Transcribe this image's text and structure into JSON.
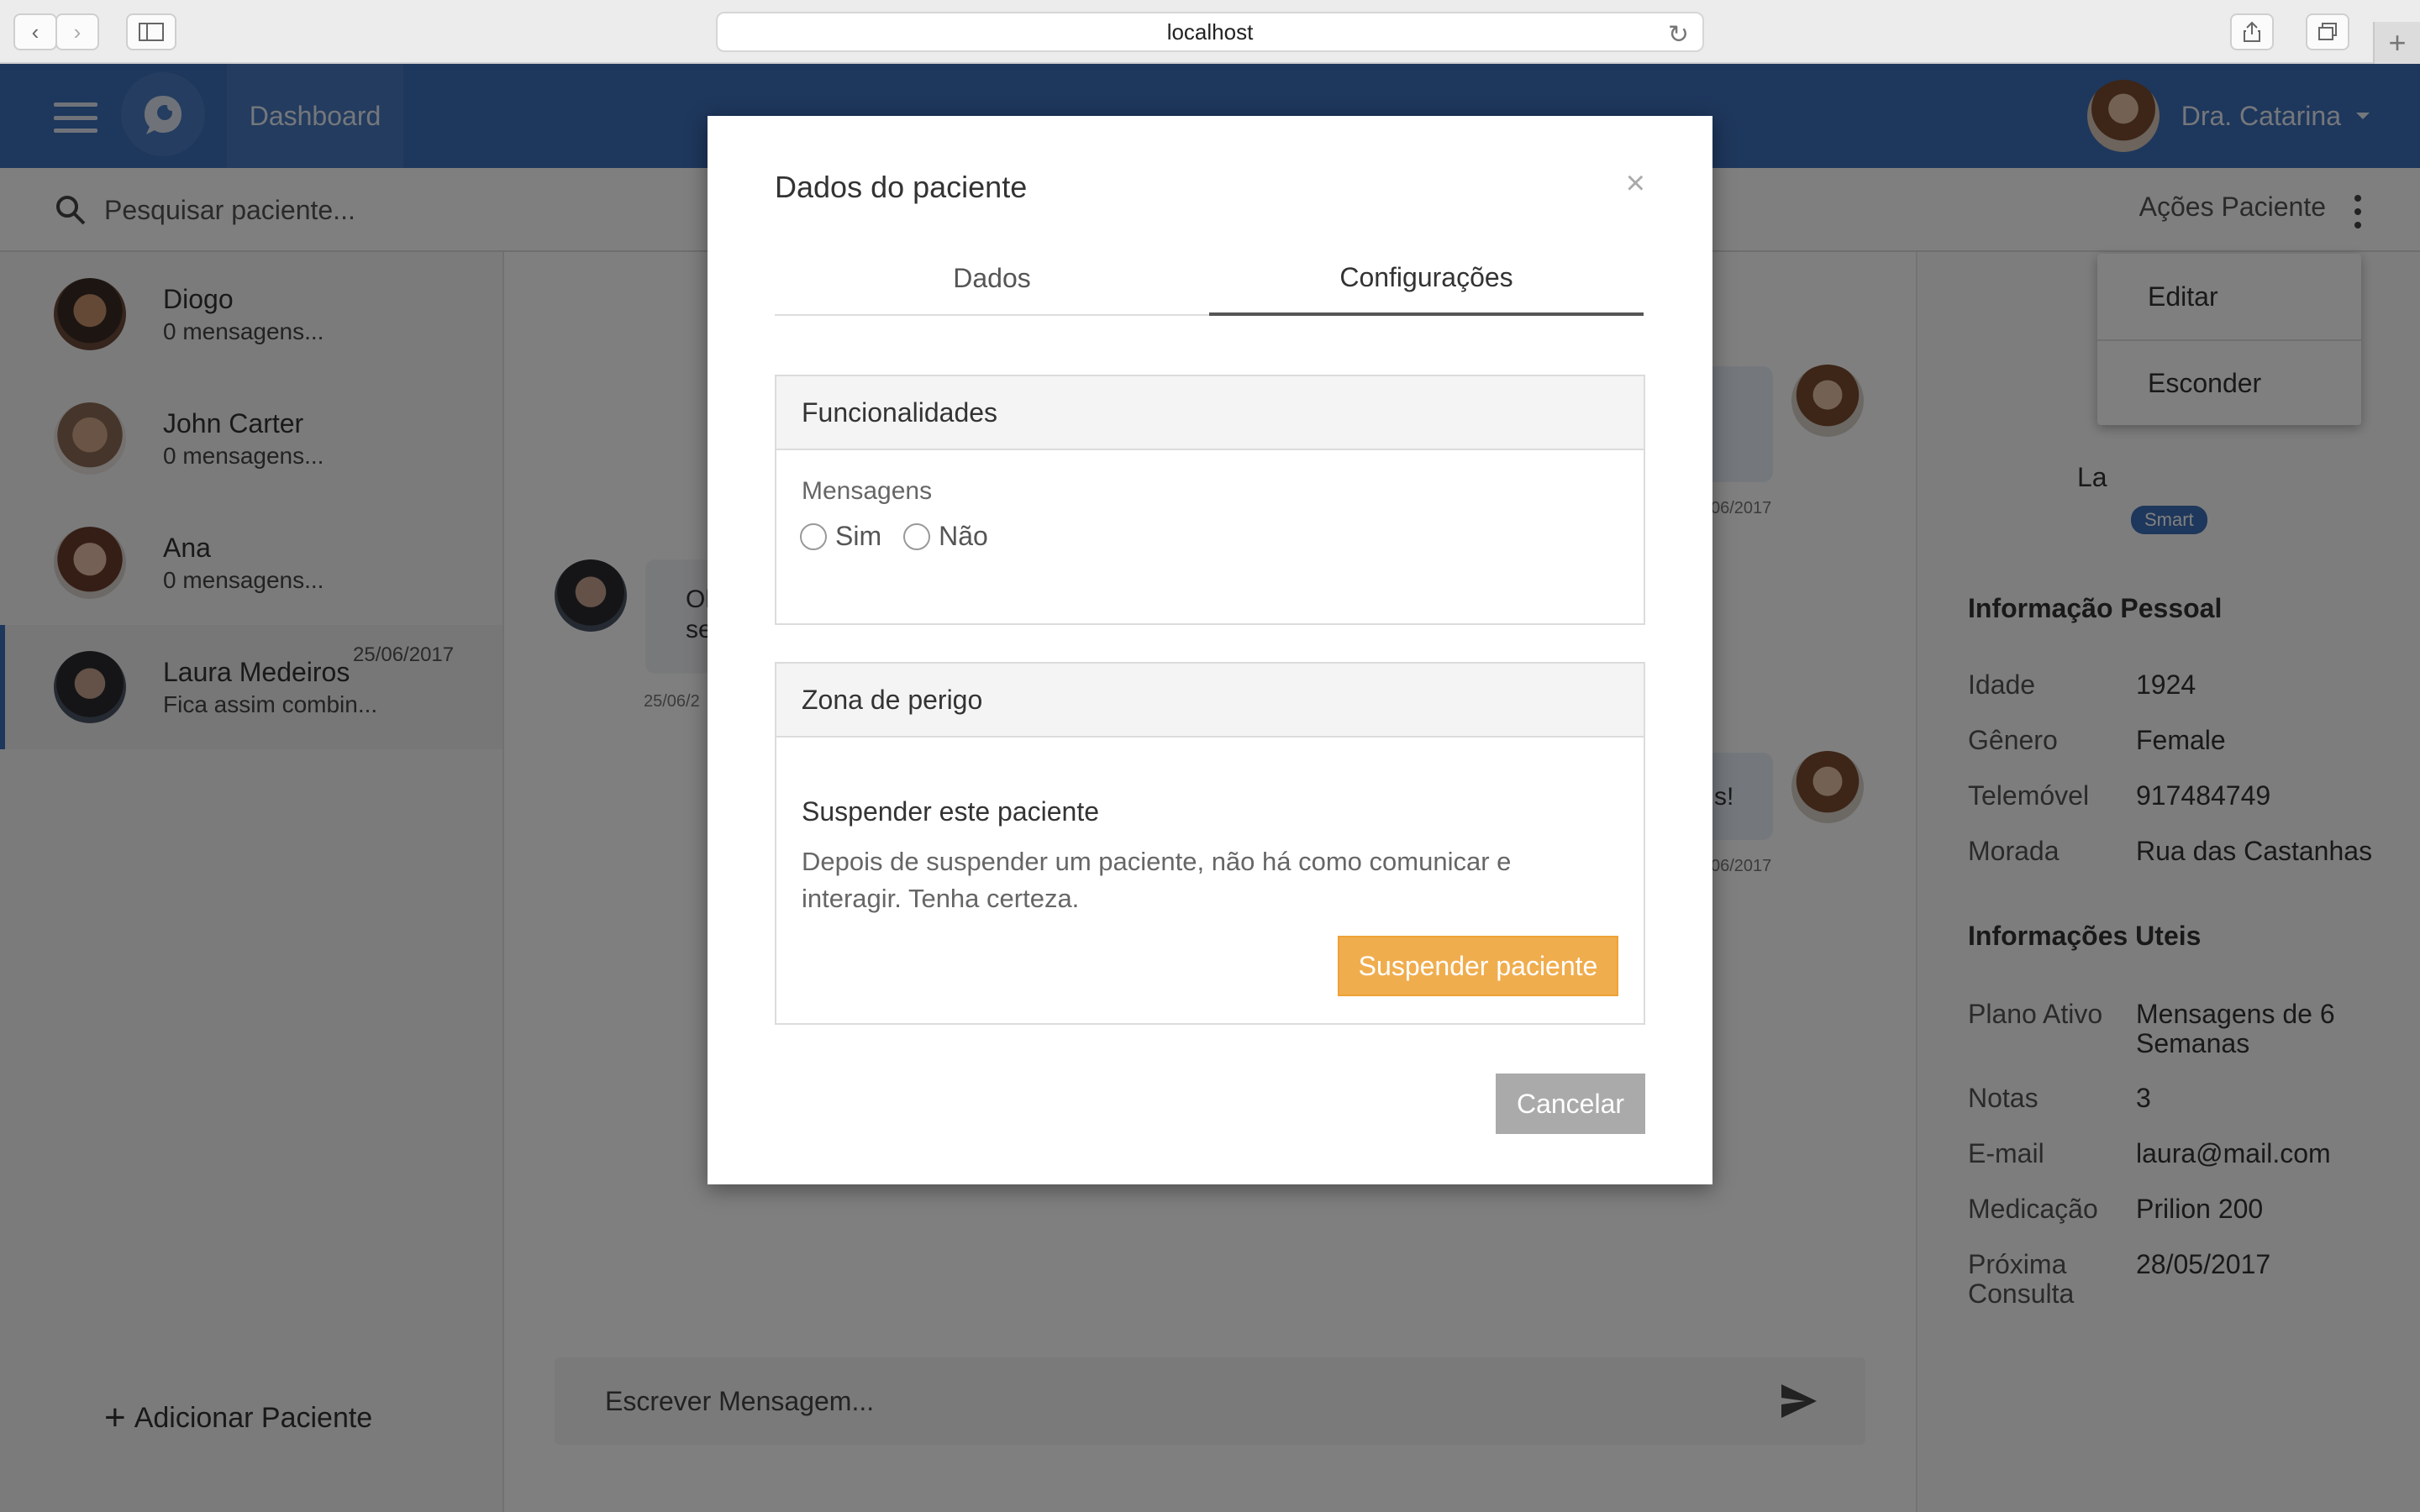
{
  "browser": {
    "url": "localhost"
  },
  "nav": {
    "dashboard_label": "Dashboard",
    "user_name": "Dra. Catarina"
  },
  "search": {
    "placeholder": "Pesquisar paciente..."
  },
  "actions": {
    "label": "Ações Paciente",
    "menu": [
      "Editar",
      "Esconder"
    ]
  },
  "patients": [
    {
      "name": "Diogo",
      "last": "0 mensagens...",
      "date": ""
    },
    {
      "name": "John Carter",
      "last": "0 mensagens...",
      "date": ""
    },
    {
      "name": "Ana",
      "last": "0 mensagens...",
      "date": ""
    },
    {
      "name": "Laura Medeiros",
      "last": "Fica assim combin...",
      "date": "25/06/2017"
    }
  ],
  "add_patient_label": "Adicionar Paciente",
  "chat": {
    "composer_placeholder": "Escrever Mensagem...",
    "fragments": {
      "incoming_text": "Ol\nse",
      "incoming_date": "25/06/2",
      "outgoing_date_1": "06/2017",
      "outgoing_text_2": "s!",
      "outgoing_date_2": "06/2017"
    }
  },
  "profile": {
    "name_fragment": "La",
    "badge": "Smart",
    "personal_heading": "Informação Pessoal",
    "personal": [
      {
        "k": "Idade",
        "v": "1924"
      },
      {
        "k": "Gênero",
        "v": "Female"
      },
      {
        "k": "Telemóvel",
        "v": "917484749"
      },
      {
        "k": "Morada",
        "v": "Rua das Castanhas"
      }
    ],
    "useful_heading": "Informações Uteis",
    "useful": [
      {
        "k": "Plano Ativo",
        "v": "Mensagens de 6 Semanas"
      },
      {
        "k": "Notas",
        "v": "3"
      },
      {
        "k": "E-mail",
        "v": "laura@mail.com"
      },
      {
        "k": "Medicação",
        "v": "Prilion 200"
      },
      {
        "k": "Próxima Consulta",
        "v": "28/05/2017"
      }
    ]
  },
  "modal": {
    "title": "Dados do paciente",
    "close": "×",
    "tabs": [
      "Dados",
      "Configurações"
    ],
    "features": {
      "heading": "Funcionalidades",
      "field_label": "Mensagens",
      "options": [
        "Sim",
        "Não"
      ]
    },
    "danger": {
      "heading": "Zona de perigo",
      "title": "Suspender este paciente",
      "description": "Depois de suspender um paciente, não há como comunicar e interagir. Tenha certeza.",
      "button": "Suspender paciente"
    },
    "cancel": "Cancelar"
  },
  "colors": {
    "primary": "#3c6fb9",
    "warning": "#f0ad4e",
    "cancel": "#aaaaaa"
  }
}
